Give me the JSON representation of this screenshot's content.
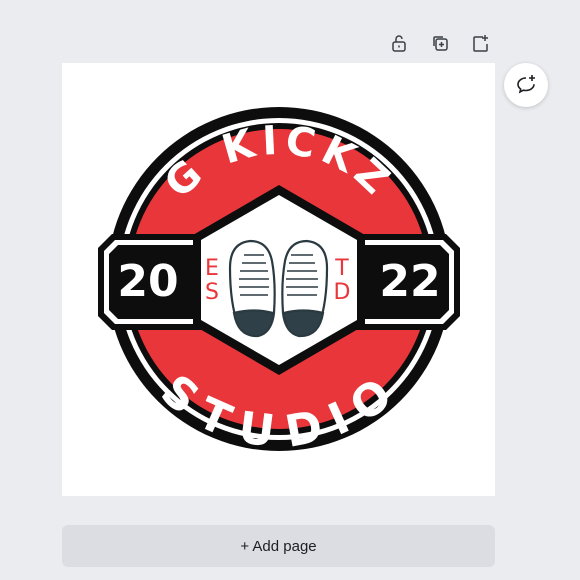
{
  "toolbar": {
    "lock_icon": "unlock-icon",
    "duplicate_icon": "duplicate-page-icon",
    "add_icon": "add-page-icon"
  },
  "comment": {
    "icon": "comment-add-icon"
  },
  "logo": {
    "top_text": "G KICKZ",
    "bottom_text": "STUDIO",
    "year_left": "20",
    "year_right": "22",
    "est_left": "ES",
    "est_right": "TD",
    "colors": {
      "red": "#e8363a",
      "black": "#0d0d0d",
      "white": "#ffffff",
      "shoe_toe": "#2f4048"
    }
  },
  "add_page": {
    "label": "+ Add page"
  }
}
